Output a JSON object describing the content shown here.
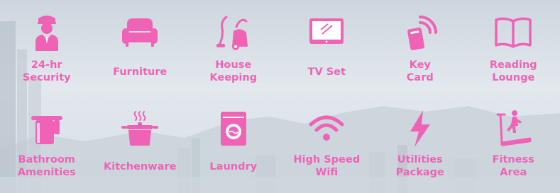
{
  "colors": {
    "accent": "#f062b6"
  },
  "amenities": [
    {
      "icon": "security-guard-icon",
      "label": "24-hr\nSecurity"
    },
    {
      "icon": "sofa-icon",
      "label": "Furniture"
    },
    {
      "icon": "vacuum-cleaner-icon",
      "label": "House\nKeeping"
    },
    {
      "icon": "tv-icon",
      "label": "TV Set"
    },
    {
      "icon": "key-card-icon",
      "label": "Key\nCard"
    },
    {
      "icon": "open-book-icon",
      "label": "Reading\nLounge"
    },
    {
      "icon": "towel-rack-icon",
      "label": "Bathroom\nAmenities"
    },
    {
      "icon": "cooking-pot-icon",
      "label": "Kitchenware"
    },
    {
      "icon": "washing-machine-icon",
      "label": "Laundry"
    },
    {
      "icon": "wifi-icon",
      "label": "High Speed\nWifi"
    },
    {
      "icon": "lightning-bolt-icon",
      "label": "Utilities\nPackage"
    },
    {
      "icon": "treadmill-icon",
      "label": "Fitness\nArea"
    }
  ]
}
